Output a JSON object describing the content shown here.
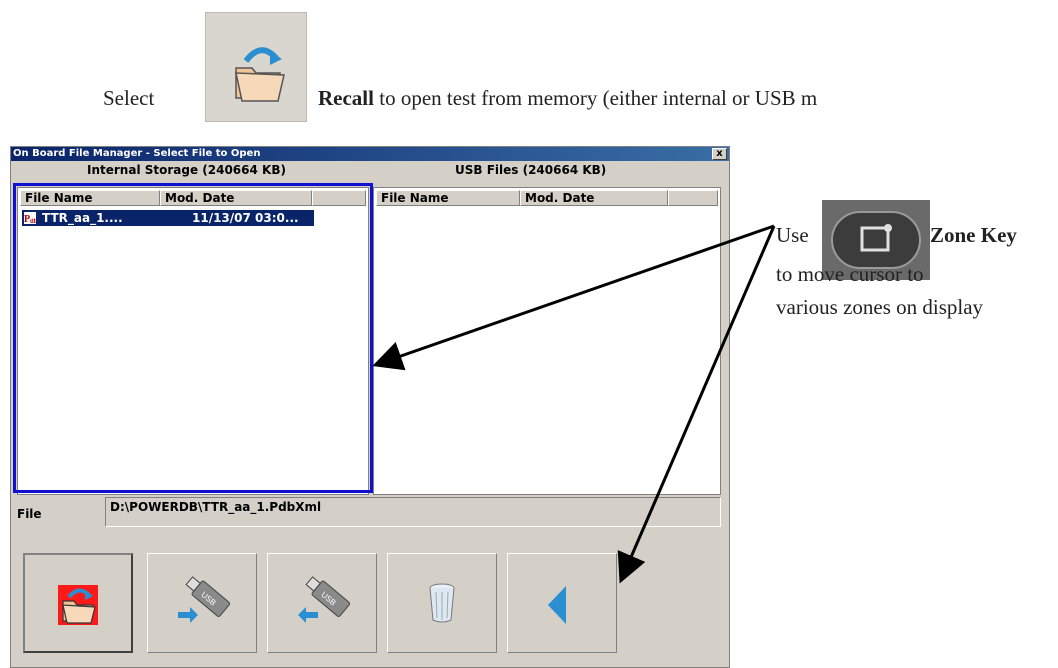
{
  "caption": {
    "select": "Select",
    "recall_bold": "Recall",
    "recall_rest": " to open test from memory (either internal or USB m"
  },
  "dialog": {
    "title": "On Board File Manager - Select File to Open",
    "close_glyph": "x",
    "internal_label": "Internal Storage (240664 KB)",
    "usb_label": "USB Files (240664 KB)",
    "columns": {
      "file_name": "File Name",
      "mod_date": "Mod. Date"
    },
    "internal_files": [
      {
        "name": "TTR_aa_1....",
        "date": "11/13/07 03:0...",
        "icon": "powerdb-file-icon"
      }
    ],
    "file_label": "File",
    "file_path": "D:\\POWERDB\\TTR_aa_1.PdbXml",
    "toolbar": [
      {
        "name": "open",
        "icon": "open-folder-icon"
      },
      {
        "name": "copy-to-usb",
        "icon": "usb-copy-to-icon"
      },
      {
        "name": "copy-from-usb",
        "icon": "usb-copy-from-icon"
      },
      {
        "name": "delete",
        "icon": "trash-icon"
      },
      {
        "name": "back",
        "icon": "back-arrow-icon"
      }
    ]
  },
  "annotation": {
    "use": "Use",
    "zone_key": "Zone Key",
    "move": "to move cursor to",
    "zones": "various zones on display",
    "zone_key_icon": "zone-key-icon"
  },
  "colors": {
    "selection": "#0a246a",
    "zone_outline": "#1010d0",
    "dialog_bg": "#d4d0c8",
    "back_arrow": "#2a8fd0",
    "open_button_red": "#ff1a1a"
  }
}
